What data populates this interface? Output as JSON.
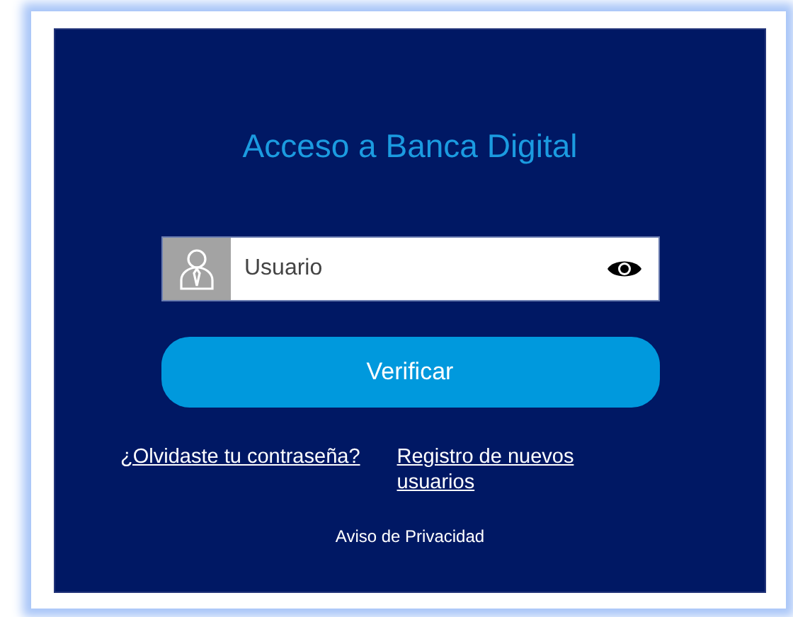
{
  "title": "Acceso a Banca Digital",
  "username_field": {
    "placeholder": "Usuario"
  },
  "verify_button": {
    "label": "Verificar"
  },
  "links": [
    {
      "label": "¿Olvidaste tu contraseña?"
    },
    {
      "label": "Registro de nuevos usuarios"
    }
  ],
  "privacy_link": {
    "label": "Aviso de Privacidad"
  }
}
